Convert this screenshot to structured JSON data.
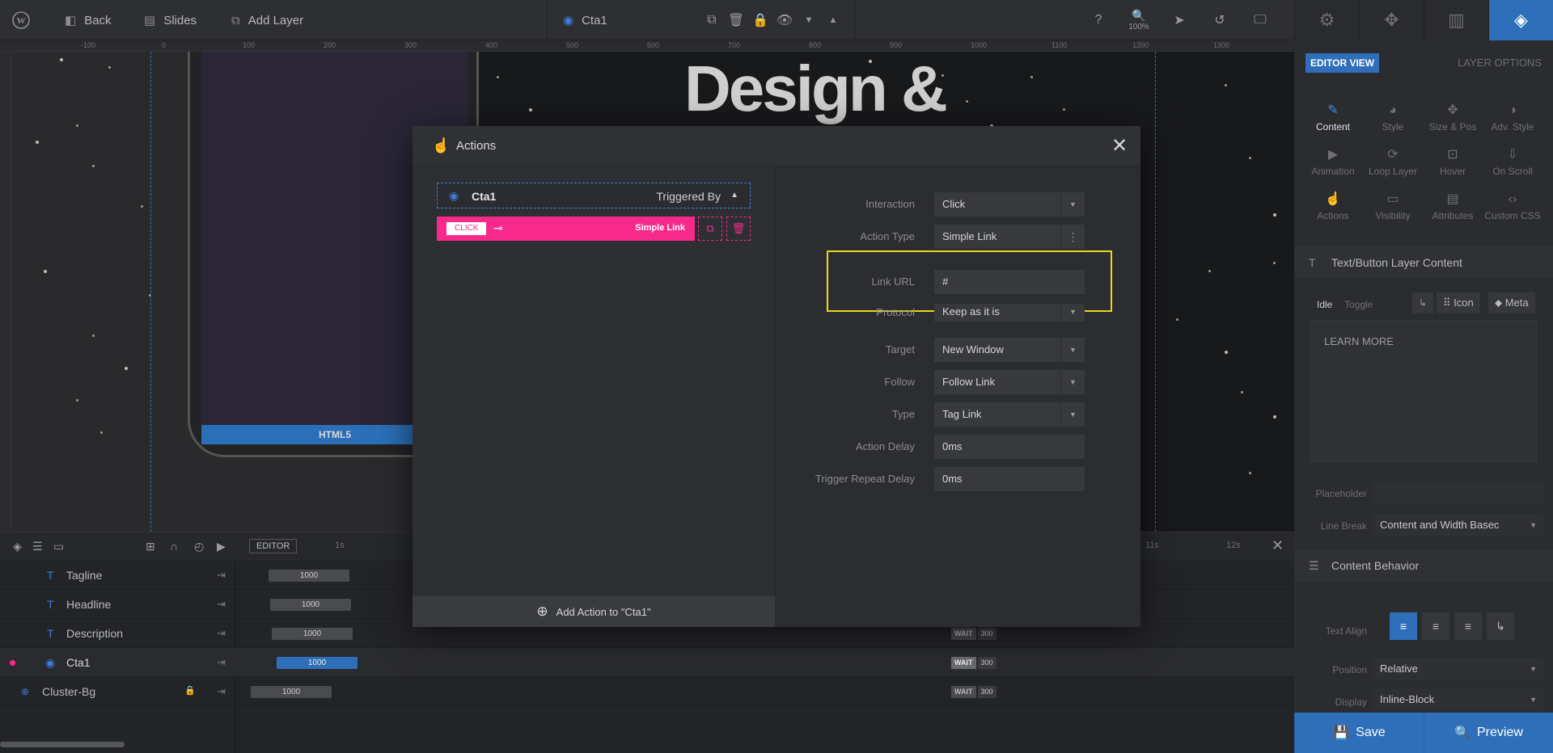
{
  "topbar": {
    "back": "Back",
    "slides": "Slides",
    "add_layer": "Add Layer",
    "layer_name": "Cta1",
    "zoom": "100%"
  },
  "ruler": [
    "-100",
    "0",
    "100",
    "200",
    "300",
    "400",
    "500",
    "600",
    "700",
    "800",
    "900",
    "1000",
    "1100",
    "1200",
    "1300",
    "14"
  ],
  "stage": {
    "headline": "Design &",
    "device_bar": "HTML5"
  },
  "timeline": {
    "editor_tab": "EDITOR",
    "time_marks": [
      "1s",
      "11s",
      "12s"
    ],
    "rows": [
      {
        "name": "Tagline",
        "duration": "1000"
      },
      {
        "name": "Headline",
        "duration": "1000"
      },
      {
        "name": "Description",
        "duration": "1000",
        "wait": "WAIT",
        "wait_val": "300"
      },
      {
        "name": "Cta1",
        "duration": "1000",
        "wait": "WAIT",
        "wait_val": "300"
      },
      {
        "name": "Cluster-Bg",
        "duration": "1000",
        "wait": "WAIT",
        "wait_val": "300"
      }
    ]
  },
  "modal": {
    "title": "Actions",
    "layer": "Cta1",
    "triggered_by": "Triggered By",
    "action_tag": "CLICK",
    "action_name": "Simple Link",
    "add_action": "Add Action to \"Cta1\"",
    "fields": [
      {
        "label": "Interaction",
        "value": "Click",
        "control": "▼"
      },
      {
        "label": "Action Type",
        "value": "Simple Link",
        "control": "⋮"
      },
      {
        "label": "Link URL",
        "value": "#",
        "control": ""
      },
      {
        "label": "Protocol",
        "value": "Keep as it is",
        "control": "▼"
      },
      {
        "label": "Target",
        "value": "New Window",
        "control": "▼"
      },
      {
        "label": "Follow",
        "value": "Follow Link",
        "control": "▼"
      },
      {
        "label": "Type",
        "value": "Tag Link",
        "control": "▼"
      },
      {
        "label": "Action Delay",
        "value": "0ms",
        "control": ""
      },
      {
        "label": "Trigger Repeat Delay",
        "value": "0ms",
        "control": ""
      }
    ]
  },
  "right_panel": {
    "editor_view": "EDITOR VIEW",
    "layer_options": "LAYER OPTIONS",
    "tools": [
      "Content",
      "Style",
      "Size & Pos",
      "Adv. Style",
      "Animation",
      "Loop Layer",
      "Hover",
      "On Scroll",
      "Actions",
      "Visibility",
      "Attributes",
      "Custom CSS"
    ],
    "section1": "Text/Button Layer Content",
    "idle": "Idle",
    "toggle": "Toggle",
    "icon": "Icon",
    "meta": "Meta",
    "content_text": "LEARN MORE",
    "placeholder_label": "Placeholder",
    "line_break_label": "Line Break",
    "line_break_value": "Content and Width Basec",
    "section2": "Content Behavior",
    "text_align_label": "Text Align",
    "position_label": "Position",
    "position_value": "Relative",
    "display_label": "Display",
    "display_value": "Inline-Block",
    "save": "Save",
    "preview": "Preview"
  },
  "colors": {
    "accent": "#2f6fba",
    "action_pink": "#f72a8c",
    "highlight": "#e8d71a"
  }
}
